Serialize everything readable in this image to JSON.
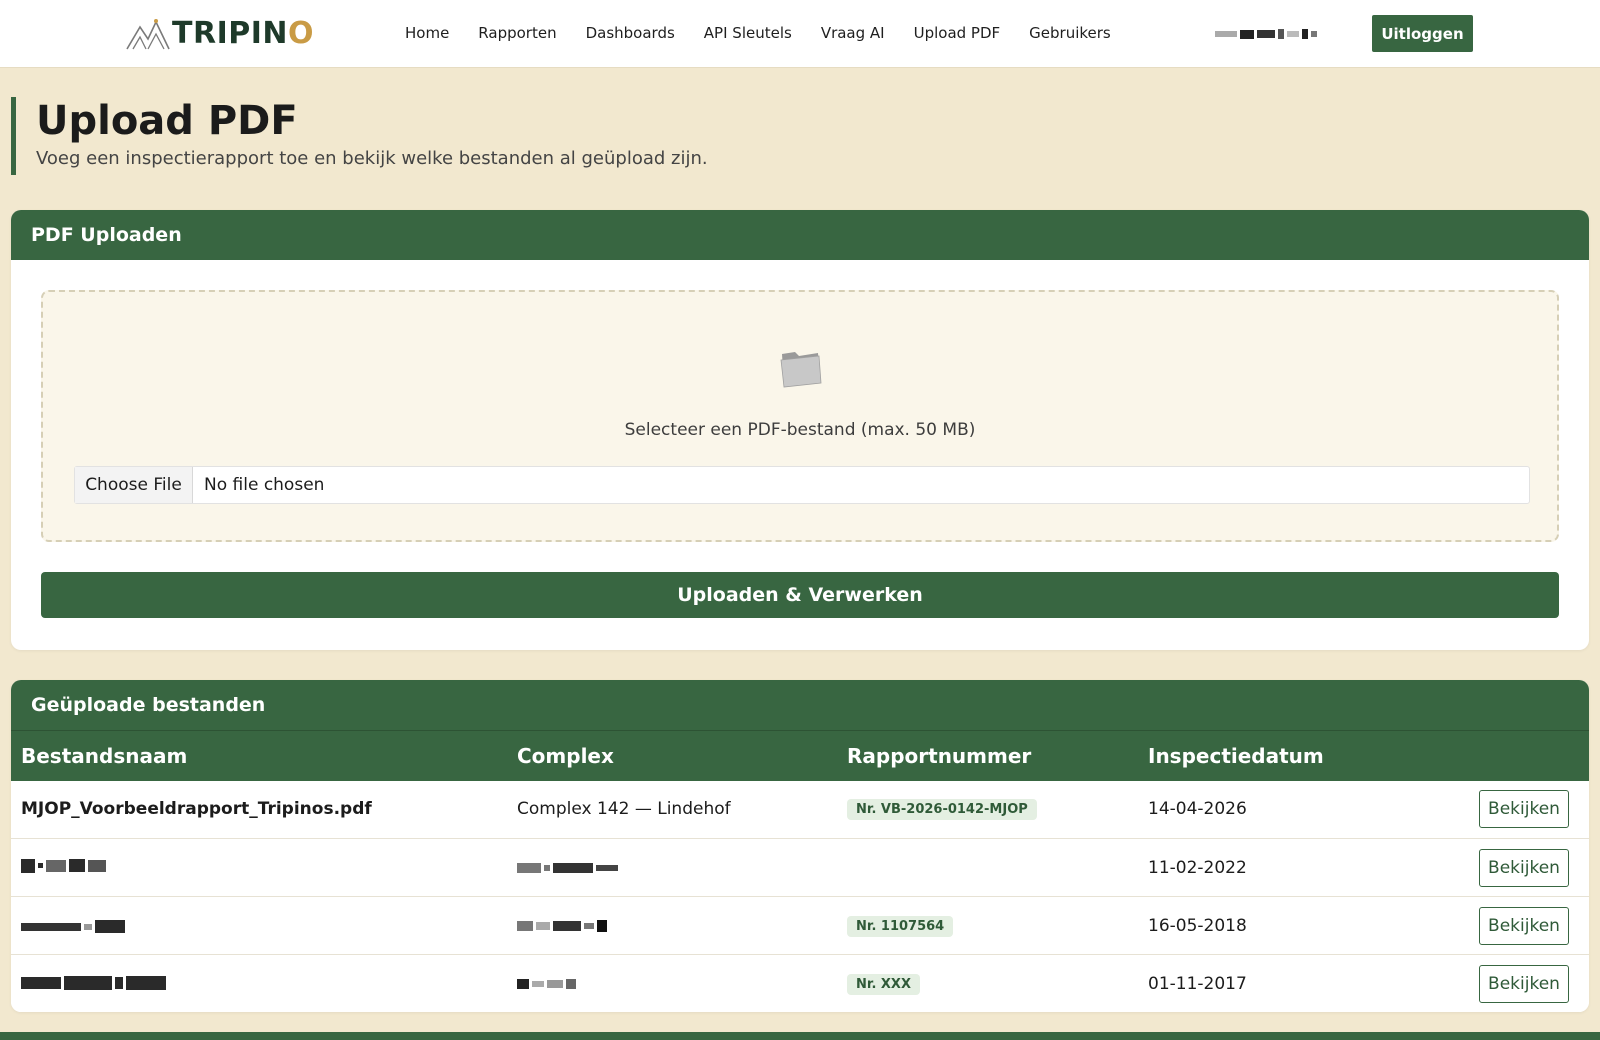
{
  "nav": {
    "logo_text_main": "TRIPIN",
    "logo_text_o": "O",
    "links": [
      "Home",
      "Rapporten",
      "Dashboards",
      "API Sleutels",
      "Vraag AI",
      "Upload PDF",
      "Gebruikers"
    ],
    "logout_label": "Uitloggen"
  },
  "header": {
    "title": "Upload PDF",
    "subtitle": "Voeg een inspectierapport toe en bekijk welke bestanden al geüpload zijn."
  },
  "upload": {
    "card_title": "PDF Uploaden",
    "drop_label": "Selecteer een PDF-bestand (max. 50 MB)",
    "choose_file_label": "Choose File",
    "file_status": "No file chosen",
    "submit_label": "Uploaden & Verwerken"
  },
  "files": {
    "card_title": "Geüploade bestanden",
    "columns": [
      "Bestandsnaam",
      "Complex",
      "Rapportnummer",
      "Inspectiedatum"
    ],
    "view_label": "Bekijken",
    "rows": [
      {
        "filename": "MJOP_Voorbeeldrapport_Tripinos.pdf",
        "complex": "Complex 142 — Lindehof",
        "report": "Nr. VB-2026-0142-MJOP",
        "date": "14-04-2026"
      },
      {
        "filename": "",
        "complex": "",
        "report": "",
        "date": "11-02-2022"
      },
      {
        "filename": "",
        "complex": "",
        "report": "Nr. 1107564",
        "date": "16-05-2018"
      },
      {
        "filename": "",
        "complex": "",
        "report": "Nr. XXX",
        "date": "01-11-2017"
      }
    ]
  },
  "colors": {
    "primary": "#386641",
    "background": "#f2e8cf",
    "accent": "#c99b45"
  }
}
